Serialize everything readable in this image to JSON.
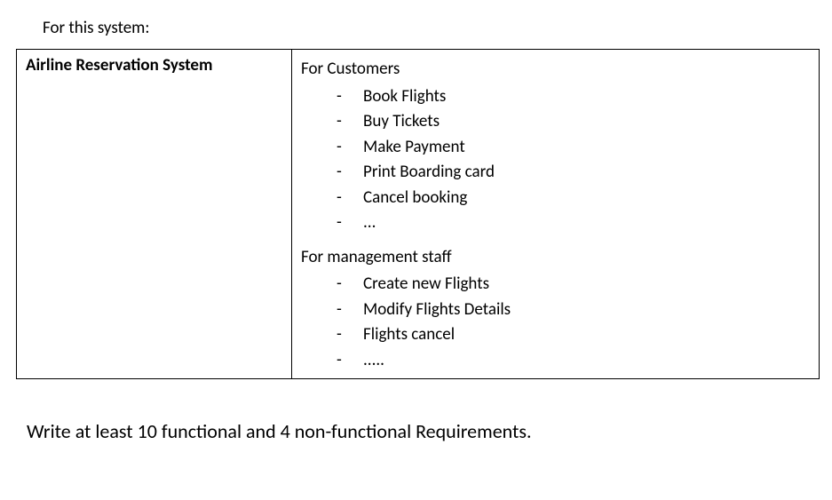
{
  "intro": "For this system:",
  "table": {
    "left_heading": "Airline Reservation System",
    "right": {
      "customers": {
        "heading": "For Customers",
        "items": [
          "Book Flights",
          "Buy Tickets",
          "Make Payment",
          "Print Boarding card",
          "Cancel booking",
          "..."
        ]
      },
      "management": {
        "heading": "For management staff",
        "items": [
          "Create new Flights",
          "Modify Flights Details",
          "Flights cancel",
          "....."
        ]
      }
    }
  },
  "instruction": "Write at least 10 functional and 4 non-functional Requirements."
}
